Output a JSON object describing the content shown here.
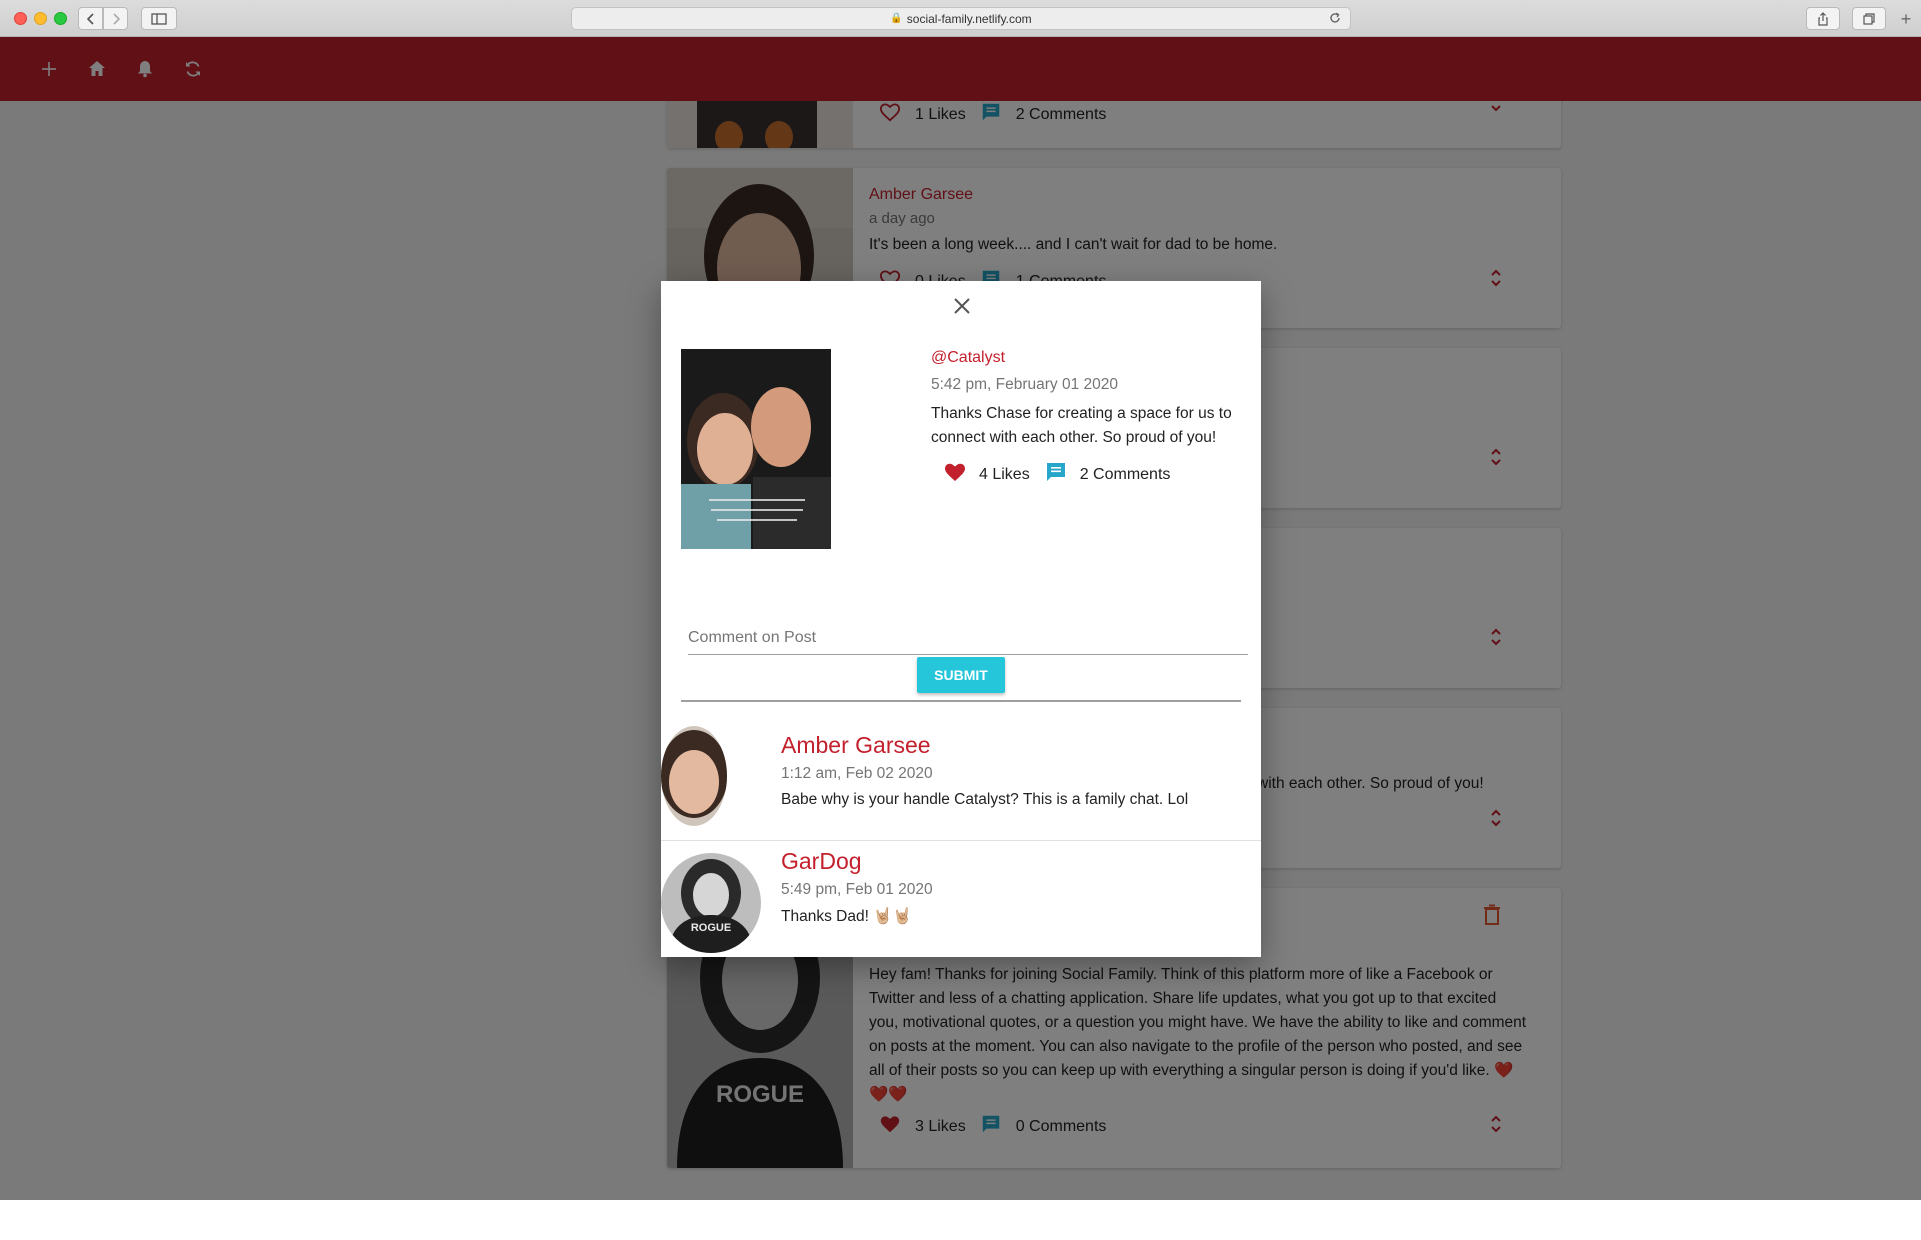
{
  "browser": {
    "url": "social-family.netlify.com",
    "lock_glyph": "🔒",
    "new_tab_glyph": "+"
  },
  "colors": {
    "brand": "#c3202d",
    "accent_button": "#26c6da",
    "comment_icon": "#26a6c9",
    "heart": "#c3202d"
  },
  "app_header": {
    "icons": [
      "plus-icon",
      "home-icon",
      "bell-icon",
      "refresh-icon"
    ]
  },
  "feed": {
    "posts": [
      {
        "likes_label": "1 Likes",
        "comments_label": "2 Comments"
      },
      {
        "author": "Amber Garsee",
        "time": "a day ago",
        "text": "It's been a long week.... and I can't wait for dad to be home.",
        "likes_label": "0 Likes",
        "comments_label": "1 Comments"
      },
      {},
      {},
      {
        "text_visible": "with each other. So proud of you!"
      },
      {
        "text": "Hey fam! Thanks for joining Social Family. Think of this platform more of like a Facebook or Twitter and less of a chatting application. Share life updates, what you got up to that excited you, motivational quotes, or a question you might have. We have the ability to like and comment on posts at the moment. You can also navigate to the profile of the person who posted, and see all of their posts so you can keep up with everything a singular person is doing if you'd like. ❤️❤️❤️",
        "likes_label": "3 Likes",
        "comments_label": "0 Comments"
      }
    ]
  },
  "modal": {
    "post": {
      "handle": "@Catalyst",
      "time": "5:42 pm, February 01 2020",
      "text": "Thanks Chase for creating a space for us to connect with each other. So proud of you!",
      "likes_label": "4 Likes",
      "comments_label": "2 Comments"
    },
    "comment_input": {
      "placeholder": "Comment on Post",
      "value": ""
    },
    "submit_label": "SUBMIT",
    "comments": [
      {
        "author": "Amber Garsee",
        "time": "1:12 am, Feb 02 2020",
        "text": "Babe why is your handle Catalyst? This is a family chat. Lol"
      },
      {
        "author": "GarDog",
        "time": "5:49 pm, Feb 01 2020",
        "text": "Thanks Dad! 🤘🏼🤘🏼"
      }
    ]
  }
}
